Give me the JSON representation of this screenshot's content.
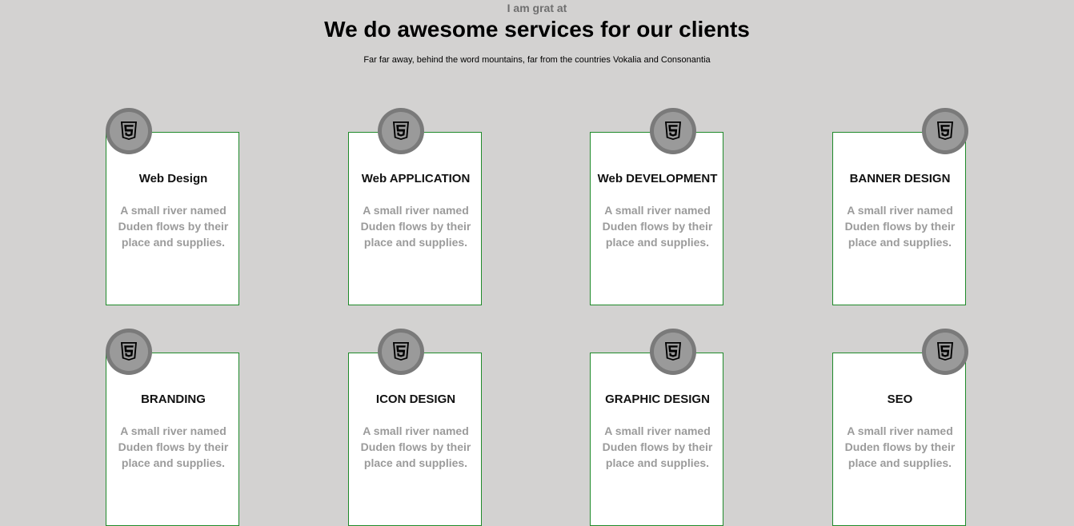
{
  "header": {
    "eyebrow": "I am grat at",
    "title": "We do awesome services for our clients",
    "subtitle": "Far far away, behind the word mountains, far from the countries Vokalia and Consonantia"
  },
  "services": [
    {
      "title": "Web Design",
      "text": "A small river named Duden flows by their place and supplies.",
      "icon": "html5-icon"
    },
    {
      "title": "Web APPLICATION",
      "text": "A small river named Duden flows by their place and supplies.",
      "icon": "html5-icon"
    },
    {
      "title": "Web DEVELOPMENT",
      "text": "A small river named Duden flows by their place and supplies.",
      "icon": "html5-icon"
    },
    {
      "title": "BANNER DESIGN",
      "text": "A small river named Duden flows by their place and supplies.",
      "icon": "html5-icon"
    },
    {
      "title": "BRANDING",
      "text": "A small river named Duden flows by their place and supplies.",
      "icon": "html5-icon"
    },
    {
      "title": "ICON DESIGN",
      "text": "A small river named Duden flows by their place and supplies.",
      "icon": "html5-icon"
    },
    {
      "title": "GRAPHIC DESIGN",
      "text": "A small river named Duden flows by their place and supplies.",
      "icon": "html5-icon"
    },
    {
      "title": "SEO",
      "text": "A small river named Duden flows by their place and supplies.",
      "icon": "html5-icon"
    }
  ],
  "colors": {
    "background": "#d3d2d1",
    "card_border": "#1f8a2a",
    "badge": "#7a7a7a",
    "muted_text": "#9b9b9b"
  }
}
